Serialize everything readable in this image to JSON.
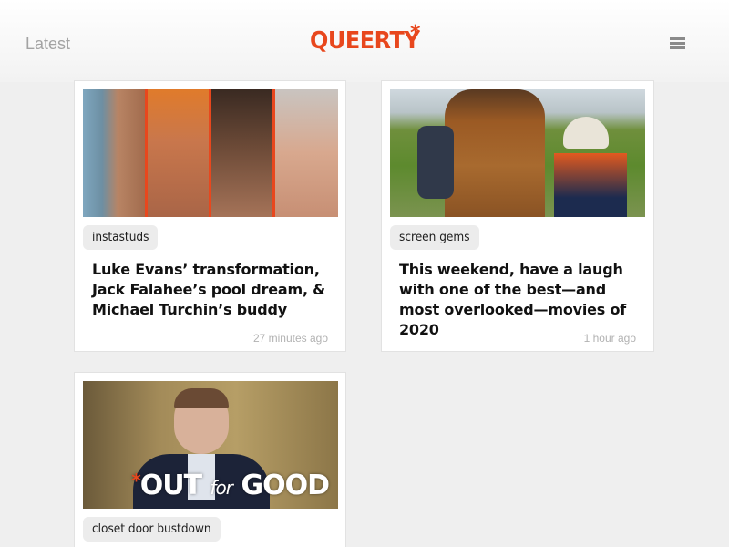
{
  "header": {
    "latest_label": "Latest",
    "logo_text": "QUEERTY",
    "logo_star": "*",
    "brand_color": "#e8471d",
    "menu_icon": "hamburger-menu-icon"
  },
  "cards": [
    {
      "tag": "instastuds",
      "headline": "Luke Evans’ transformation, Jack Falahee’s pool dream, & Michael Turchin’s buddy",
      "timestamp": "27 minutes ago"
    },
    {
      "tag": "screen gems",
      "headline": "This weekend, have a laugh with one of the best—and most overlooked—movies of 2020",
      "timestamp": "1 hour ago"
    },
    {
      "tag": "closet door bustdown",
      "thumb_logo": {
        "star": "*",
        "out": "OUT",
        "for": "for",
        "good": "GOOD"
      }
    }
  ]
}
